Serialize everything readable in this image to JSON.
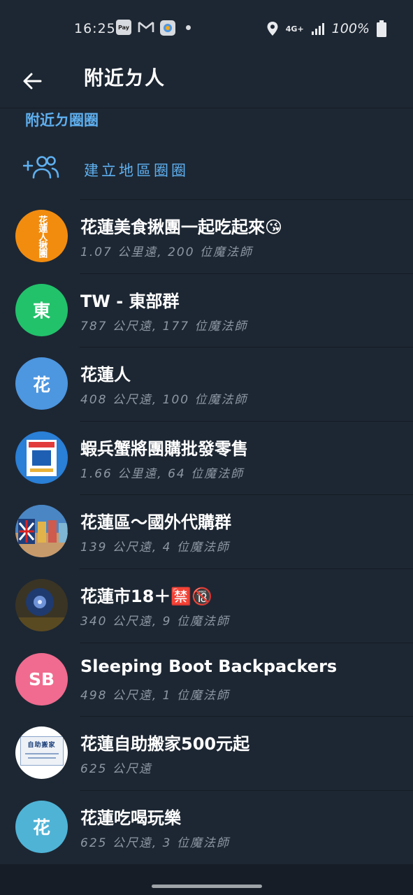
{
  "status": {
    "time": "16:25",
    "pay_label": "Pay",
    "network": "4G+",
    "battery": "100%"
  },
  "header": {
    "title": "附近ㄉ人"
  },
  "section": {
    "title": "附近ㄉ圈圈",
    "create_label": "建立地區圈圈"
  },
  "groups": [
    {
      "title": "花蓮美食揪團一起吃起來😘",
      "subtitle": "1.07 公里遠, 200 位魔法師",
      "avatar_text": "花蓮人揪團",
      "avatar_color": "#f28c0f"
    },
    {
      "title": "TW - 東部群",
      "subtitle": "787 公尺遠, 177 位魔法師",
      "avatar_text": "東",
      "avatar_color": "#22c26b"
    },
    {
      "title": "花蓮人",
      "subtitle": "408 公尺遠, 100 位魔法師",
      "avatar_text": "花",
      "avatar_color": "#4d96e0"
    },
    {
      "title": "蝦兵蟹將團購批發零售",
      "subtitle": "1.66 公里遠, 64 位魔法師",
      "avatar_text": "",
      "avatar_color": "#2a7fd6"
    },
    {
      "title": "花蓮區～國外代購群",
      "subtitle": "139 公尺遠, 4 位魔法師",
      "avatar_text": "",
      "avatar_color": "#6a4e3a"
    },
    {
      "title": "花蓮市18＋🈲🔞",
      "subtitle": "340 公尺遠, 9 位魔法師",
      "avatar_text": "",
      "avatar_color": "#2c2f3a"
    },
    {
      "title": "Sleeping Boot Backpackers",
      "subtitle": "498 公尺遠, 1 位魔法師",
      "avatar_text": "SB",
      "avatar_color": "#f06b8f"
    },
    {
      "title": "花蓮自助搬家500元起",
      "subtitle": "625 公尺遠",
      "avatar_text": "自助搬家",
      "avatar_color": "#ffffff"
    },
    {
      "title": "花蓮吃喝玩樂",
      "subtitle": "625 公尺遠, 3 位魔法師",
      "avatar_text": "花",
      "avatar_color": "#4fb3d6"
    }
  ]
}
